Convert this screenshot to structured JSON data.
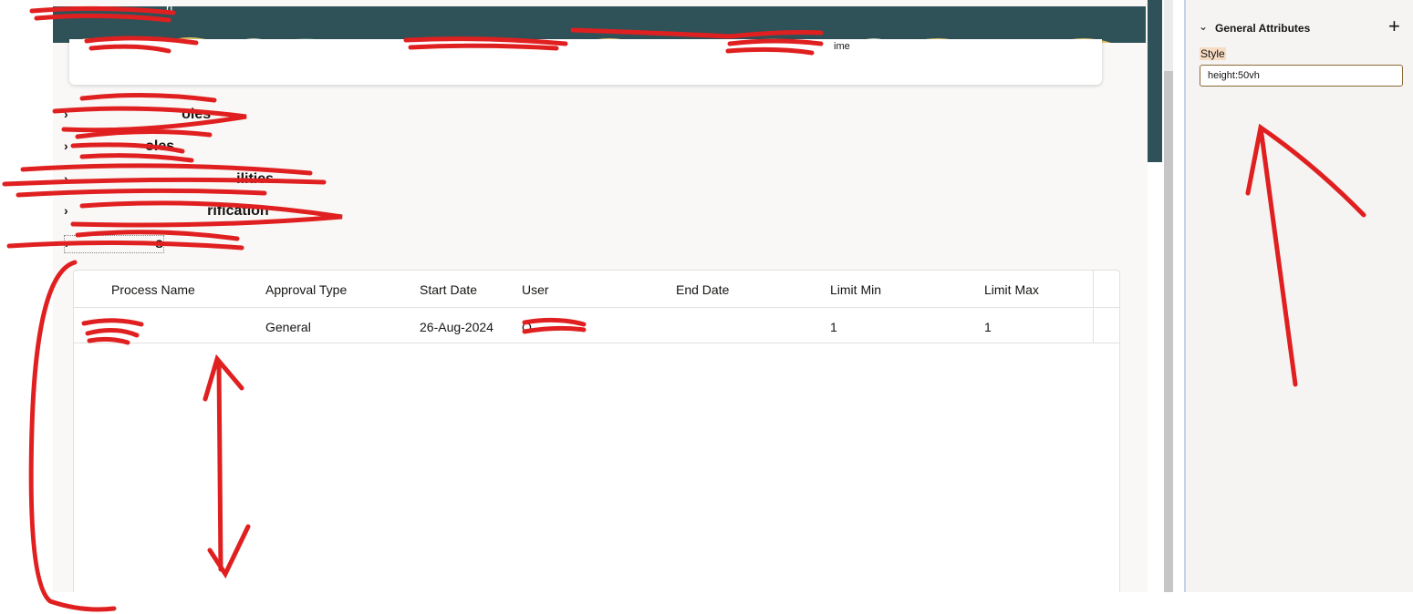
{
  "banner": {
    "title_fragment": "n",
    "caption_fragment": "ime"
  },
  "sections": [
    {
      "label": "oles"
    },
    {
      "label": "oles"
    },
    {
      "label": "ilities"
    },
    {
      "label": "rification"
    },
    {
      "label": "s"
    }
  ],
  "table": {
    "columns": [
      "Process Name",
      "Approval Type",
      "Start Date",
      "User",
      "End Date",
      "Limit Min",
      "Limit Max"
    ],
    "rows": [
      {
        "process_name": "",
        "approval_type": "General",
        "start_date": "26-Aug-2024",
        "user": "O",
        "end_date": "",
        "limit_min": "1",
        "limit_max": "1"
      }
    ]
  },
  "panel": {
    "section_title": "General Attributes",
    "add_icon": "plus-icon",
    "style_label": "Style",
    "style_value": "height:50vh"
  },
  "colors": {
    "banner": "#2f5258",
    "annotation": "#e02020",
    "canvas": "#f9f8f6"
  }
}
